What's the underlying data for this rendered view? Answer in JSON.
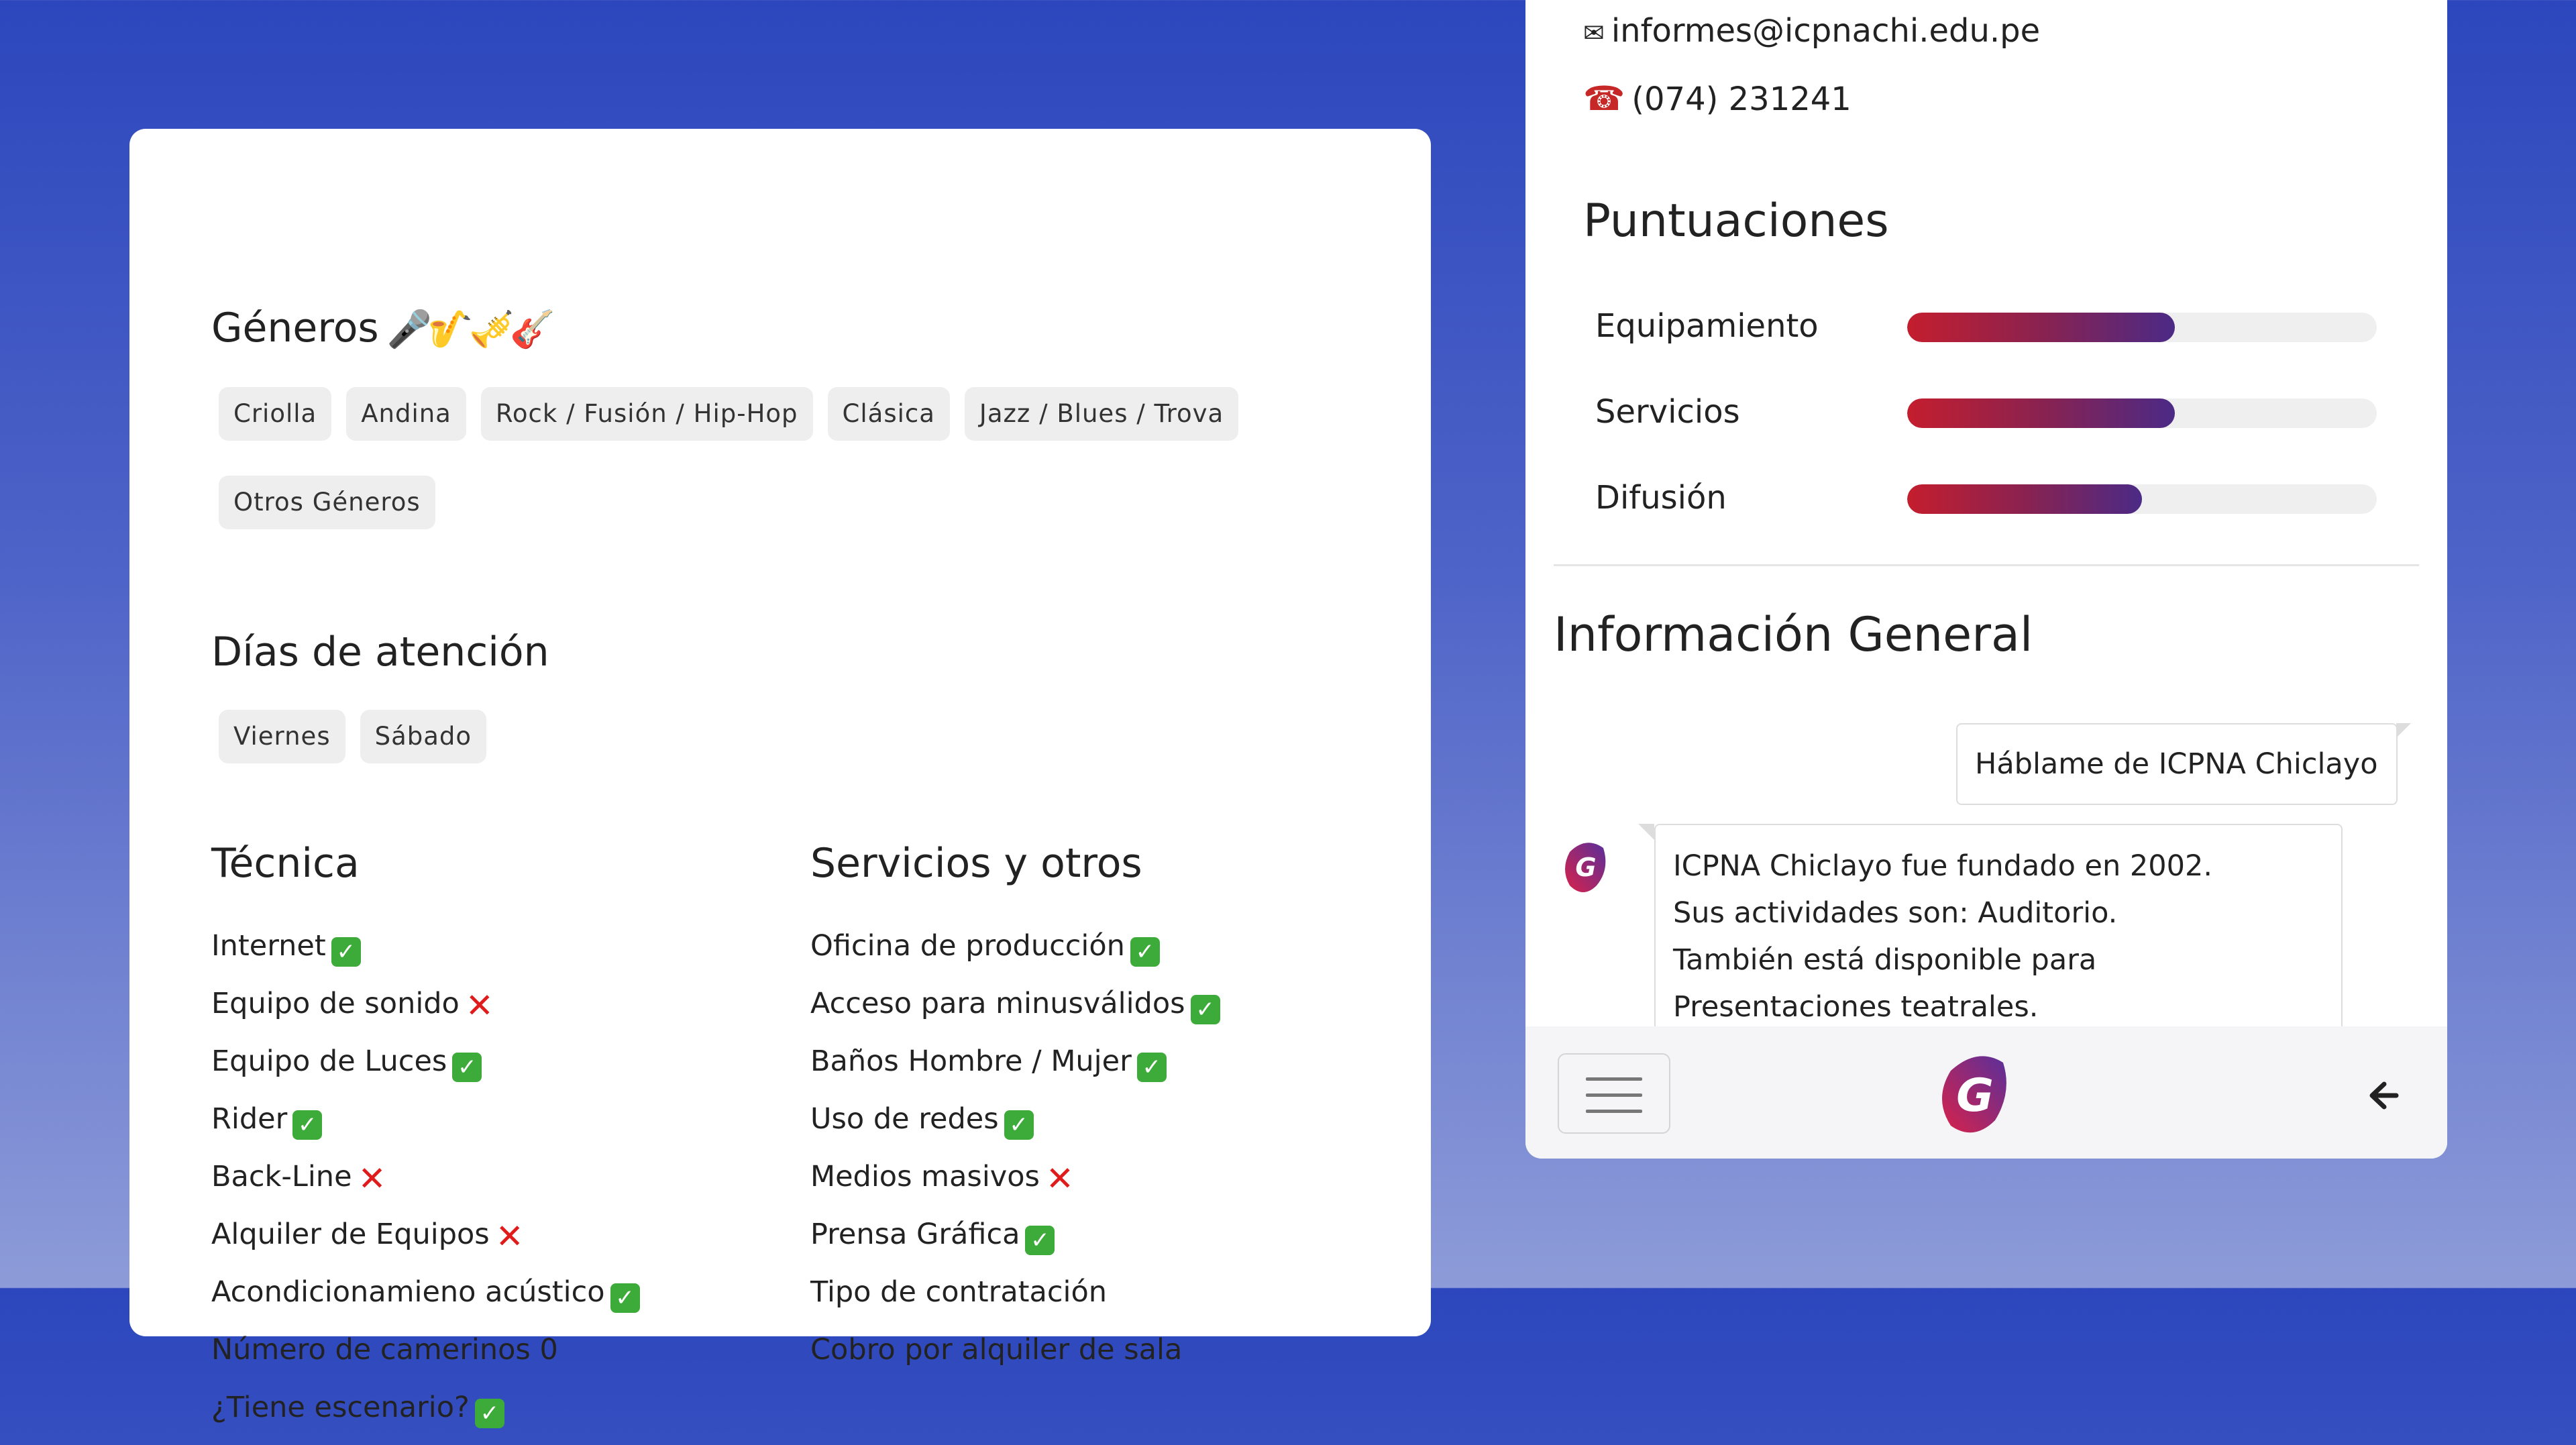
{
  "left": {
    "generos_title": "Géneros",
    "generos_emoji": "🎤🎷🎺🎸",
    "generos": [
      "Criolla",
      "Andina",
      "Rock / Fusión / Hip-Hop",
      "Clásica",
      "Jazz / Blues / Trova",
      "Otros Géneros"
    ],
    "dias_title": "Días de atención",
    "dias": [
      "Viernes",
      "Sábado"
    ],
    "tecnica_title": "Técnica",
    "tecnica": [
      {
        "label": "Internet",
        "mark": "✓"
      },
      {
        "label": "Equipo de sonido",
        "mark": "✕"
      },
      {
        "label": "Equipo de Luces",
        "mark": "✓"
      },
      {
        "label": "Rider",
        "mark": "✓"
      },
      {
        "label": "Back-Line",
        "mark": "✕"
      },
      {
        "label": "Alquiler de Equipos",
        "mark": "✕"
      },
      {
        "label": "Acondicionamieno acústico",
        "mark": "✓"
      },
      {
        "label": "Número de camerinos 0",
        "mark": ""
      },
      {
        "label": "¿Tiene escenario?",
        "mark": "✓"
      }
    ],
    "servicios_title": "Servicios y otros",
    "servicios": [
      {
        "label": "Oficina de producción",
        "mark": "✓"
      },
      {
        "label": "Acceso para minusválidos",
        "mark": "✓"
      },
      {
        "label": "Baños Hombre / Mujer",
        "mark": "✓"
      },
      {
        "label": "Uso de redes",
        "mark": "✓"
      },
      {
        "label": "Medios masivos",
        "mark": "✕"
      },
      {
        "label": "Prensa Gráfica",
        "mark": "✓"
      },
      {
        "label": "Tipo de contratación",
        "mark": ""
      },
      {
        "label": "Cobro por alquiler de sala",
        "mark": ""
      }
    ]
  },
  "right": {
    "email_icon": "✉",
    "email": "informes@icpnachi.edu.pe",
    "phone_icon": "☎",
    "phone": "(074) 231241",
    "puntuaciones_title": "Puntuaciones",
    "scores": [
      {
        "label": "Equipamiento",
        "value": 0.57
      },
      {
        "label": "Servicios",
        "value": 0.57
      },
      {
        "label": "Difusión",
        "value": 0.5
      }
    ],
    "info_title": "Información General",
    "user_message": "Háblame de ICPNA Chiclayo",
    "bot_lines": [
      "ICPNA Chiclayo fue fundado en 2002.",
      "Sus actividades son: Auditorio.",
      "También está disponible para",
      "Presentaciones teatrales."
    ],
    "colors": {
      "bar_start": "#c41e2e",
      "bar_end": "#4b2a86",
      "logo_start": "#d8224a",
      "logo_end": "#5a2f9a"
    }
  }
}
